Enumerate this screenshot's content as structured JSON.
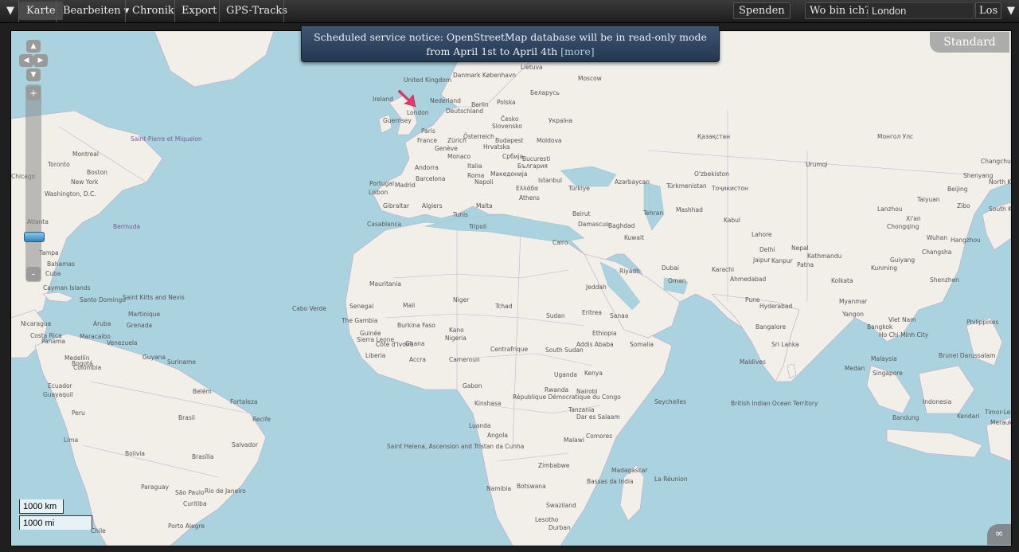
{
  "toolbar": {
    "menu_toggle": "▼",
    "tabs": [
      "Karte",
      "Bearbeiten ▾",
      "Chronik",
      "Export",
      "GPS-Tracks"
    ],
    "donate": "Spenden",
    "whereami": "Wo bin ich?",
    "search_value": "London",
    "go": "Los",
    "right_toggle": "▼"
  },
  "notice": {
    "text": "Scheduled service notice: OpenStreetMap database will be in read-only mode from April 1st to April 4th",
    "more": "[more]"
  },
  "layer_switcher": "Standard",
  "zoom": {
    "plus": "+",
    "minus": "-"
  },
  "scale": {
    "km": "1000 km",
    "mi": "1000 mi"
  },
  "permalink_icon": "∞",
  "map_labels": {
    "countries": [
      "United Kingdom",
      "Ireland",
      "Danmark København",
      "Lietuva",
      "Moscow",
      "Беларусь",
      "Nederland",
      "Berlin",
      "Polska",
      "Deutschland",
      "London",
      "Guernsey",
      "Česko",
      "Україна",
      "Slovensko",
      "Paris",
      "France",
      "Österreich",
      "Budapest",
      "Moldova",
      "Genève",
      "Hrvatska",
      "Zürich",
      "Србија",
      "Bucuresti",
      "България",
      "Andorra",
      "Monaco",
      "Italia",
      "Roma",
      "Македонија",
      "Portugal",
      "Madrid",
      "Barcelona",
      "Napoli",
      "Istanbul",
      "Türkiye",
      "Ελλάδα",
      "Athens",
      "Gibraltar",
      "Algiers",
      "Malta",
      "Tunis",
      "Lisbon",
      "Casablanca",
      "Tripoli",
      "Cairo",
      "Beirut",
      "Damascus",
      "Baghdad",
      "Kuwait",
      "Tehran",
      "Mashhad",
      "Kabul",
      "Lahore",
      "Nepal",
      "Kathmandu",
      "Delhi",
      "Jaipur",
      "Kanpur",
      "Patna",
      "Kolkata",
      "Karachi",
      "Ahmedabad",
      "Pune",
      "Hyderabad",
      "Bangalore",
      "Sri Lanka",
      "Riyadh",
      "Dubai",
      "Oman",
      "Jeddah",
      "Sanaa",
      "Eritrea",
      "Ethiopia",
      "Addis Ababa",
      "Somalia",
      "Kenya",
      "Uganda",
      "Rwanda",
      "Nairobi",
      "Tanzania",
      "Dar es Salaam",
      "Malawi",
      "Angola",
      "Luanda",
      "Kinshasa",
      "Gabon",
      "République Démocratique du Congo",
      "Zimbabwe",
      "Botswana",
      "Namibia",
      "Swaziland",
      "Lesotho",
      "Durban",
      "Madagascar",
      "Comores",
      "Seychelles",
      "Maldives",
      "La Réunion",
      "Bassas da India",
      "Saint Helena, Ascension and Tristan da Cunha",
      "Mali",
      "Niger",
      "Tchad",
      "Mauritania",
      "Burkina Faso",
      "Ghana",
      "Kano",
      "Nigeria",
      "Cameroun",
      "Centrafrique",
      "South Sudan",
      "Sudan",
      "Senegal",
      "The Gambia",
      "Guinée",
      "Sierra Leone",
      "Liberia",
      "Côte d'Ivoire",
      "Accra",
      "Cabo Verde",
      "Montreal",
      "Toronto",
      "Boston",
      "New York",
      "Washington, D.C.",
      "Chicago",
      "Bermuda",
      "Saint-Pierre et Miquelon",
      "Atlanta",
      "Tampa",
      "Cuba",
      "Bahamas",
      "Cayman Islands",
      "Saint Kitts and Nevis",
      "Santo Domingo",
      "Martinique",
      "Grenada",
      "Aruba",
      "Nicaragua",
      "Costa Rica",
      "Panama",
      "Maracaibo",
      "Venezuela",
      "Medellín",
      "Bogotá",
      "Colombia",
      "Guyana",
      "Suriname",
      "Ecuador",
      "Guayaquil",
      "Peru",
      "Lima",
      "Belém",
      "Fortaleza",
      "Recife",
      "Brasil",
      "Salvador",
      "Bolivia",
      "Brasília",
      "Paraguay",
      "Rio de Janeiro",
      "São Paulo",
      "Curitiba",
      "Porto Alegre",
      "Chile",
      "Urumqi",
      "Монгол Улс",
      "Қазақстан",
      "O'zbekiston",
      "Тоҷикистон",
      "Türkmenistan",
      "Azərbaycan",
      "Shenyang",
      "Changchun",
      "Beijing",
      "North Korea",
      "South Korea",
      "Zibo",
      "Lanzhou",
      "Xi'an",
      "Wuhan",
      "Hangzhou",
      "Taiyuan",
      "Chongqing",
      "Changsha",
      "Guiyang",
      "Kunming",
      "Shenzhen",
      "Myanmar",
      "Yangon",
      "Bangkok",
      "Viet Nam",
      "Ho Chi Minh City",
      "Philippines",
      "Malaysia",
      "Brunei Darussalam",
      "Medan",
      "Singapore",
      "Indonesia",
      "Bandung",
      "Timor-Leste",
      "Kendari",
      "Merauke",
      "British Indian Ocean Territory"
    ],
    "seas": [
      "Bermuda",
      "Saint-Pierre et Miquelon"
    ]
  }
}
